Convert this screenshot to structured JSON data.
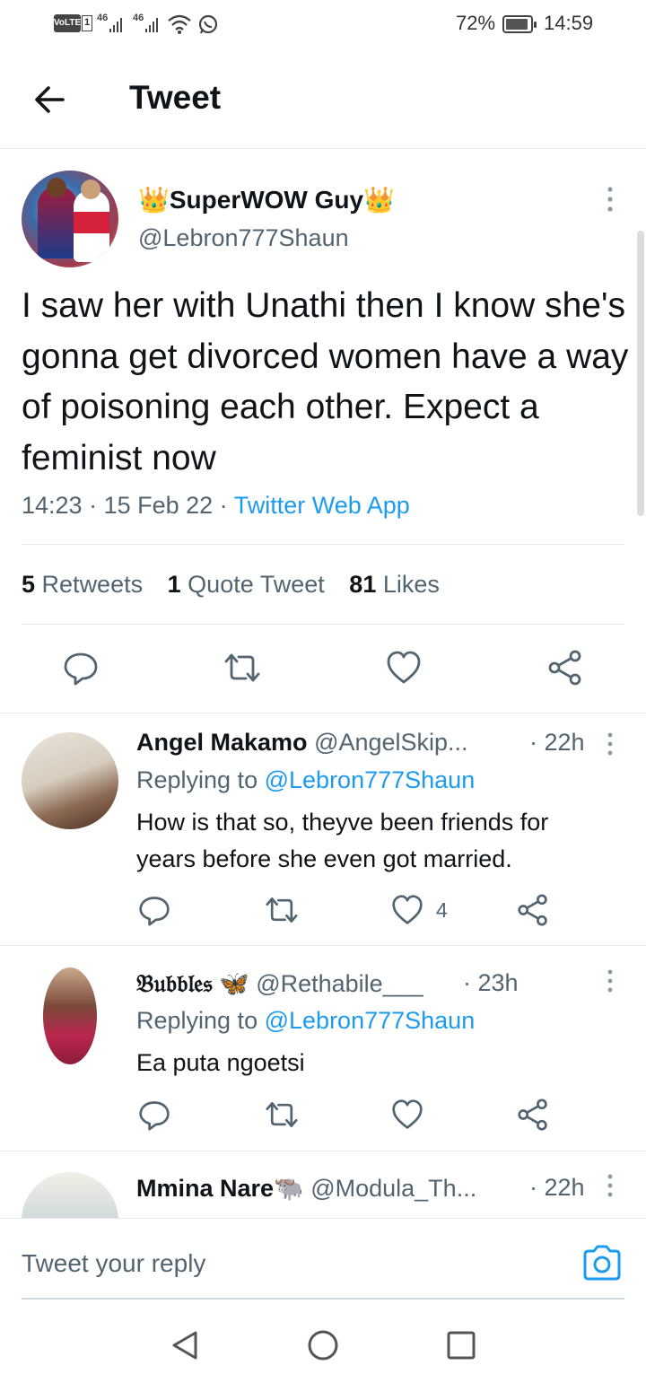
{
  "status_bar": {
    "volte": "VoLTE",
    "sim": "1",
    "net1": "46",
    "net2": "46",
    "battery_pct": "72%",
    "time": "14:59"
  },
  "header": {
    "title": "Tweet"
  },
  "tweet": {
    "author_name": "SuperWOW Guy",
    "author_emoji": "👑",
    "author_handle": "@Lebron777Shaun",
    "text": "I saw her with Unathi then I know she's gonna get divorced women have a way of poisoning each other. Expect a feminist now",
    "time": "14:23",
    "date": "15 Feb 22",
    "source": "Twitter Web App",
    "stats": {
      "retweets_count": "5",
      "retweets_label": "Retweets",
      "quotes_count": "1",
      "quotes_label": "Quote Tweet",
      "likes_count": "81",
      "likes_label": "Likes"
    }
  },
  "replies": [
    {
      "name": "Angel Makamo",
      "handle": "@AngelSkip...",
      "time": "· 22h",
      "replying_prefix": "Replying to",
      "replying_handle": "@Lebron777Shaun",
      "text_line1": "How is that so, theyve been friends for",
      "text_line2": "years before she even got married.",
      "like_count": "4"
    },
    {
      "name": "𝔅𝔲𝔟𝔟𝔩𝔢𝔰",
      "name_emoji": "🦋",
      "handle": "@Rethabile___",
      "time": "· 23h",
      "replying_prefix": "Replying to",
      "replying_handle": "@Lebron777Shaun",
      "text_line1": "Ea puta ngoetsi",
      "like_count": ""
    },
    {
      "name": "Mmina Nare",
      "name_emoji": "🐃",
      "handle": "@Modula_Th...",
      "time": "· 22h"
    }
  ],
  "reply_bar": {
    "placeholder": "Tweet your reply"
  },
  "colors": {
    "accent": "#1d9bf0",
    "secondary_text": "#536471",
    "primary_text": "#0f1419",
    "divider": "#e6e6e6"
  },
  "icons": {
    "back": "arrow-left-icon",
    "more": "more-vertical-icon",
    "reply": "speech-bubble-icon",
    "retweet": "retweet-icon",
    "like": "heart-icon",
    "share": "share-icon",
    "camera": "camera-icon",
    "nav_back": "triangle-back-icon",
    "nav_home": "circle-home-icon",
    "nav_recent": "square-recent-icon"
  }
}
